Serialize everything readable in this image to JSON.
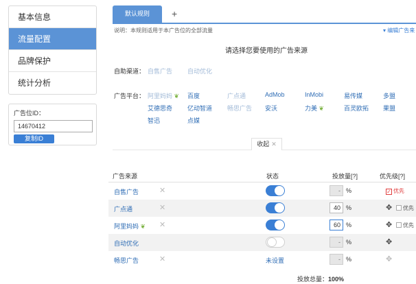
{
  "sidebar": {
    "items": [
      {
        "label": "基本信息"
      },
      {
        "label": "流量配置"
      },
      {
        "label": "品牌保护"
      },
      {
        "label": "统计分析"
      }
    ]
  },
  "ad_slot": {
    "label": "广告位ID：",
    "value": "14670412",
    "copy_label": "复制ID"
  },
  "tabs": {
    "default_label": "默认规则",
    "add_label": "+"
  },
  "note": "说明：本规则适用于本广告位的全部流量",
  "edit_note": "▾ 编辑广告来",
  "heading": "请选择您要使用的广告来源",
  "self_channel": {
    "label": "自助渠道：",
    "options": [
      "自售广告",
      "自动优化"
    ]
  },
  "platforms": {
    "label": "广告平台：",
    "items": [
      "阿里妈妈",
      "百度",
      "广点通",
      "AdMob",
      "InMobi",
      "易传媒",
      "多盟",
      "艾德思奇",
      "亿动智道",
      "畅思广告",
      "安沃",
      "力美",
      "百灵欧拓",
      "果盟",
      "智迅",
      "点媒"
    ]
  },
  "collapse": {
    "label": "收起",
    "close": "✕"
  },
  "table": {
    "headers": [
      "广告来源",
      "状态",
      "投放量[?]",
      "优先级[?]"
    ],
    "rows": [
      {
        "name": "自售广告",
        "status": "on",
        "status_text": "",
        "pct": "-",
        "priority": "优先"
      },
      {
        "name": "广点通",
        "status": "on",
        "status_text": "",
        "pct": "40",
        "priority": "优先"
      },
      {
        "name": "阿里妈妈",
        "status": "on",
        "status_text": "",
        "pct": "60",
        "priority": "优先"
      },
      {
        "name": "自动优化",
        "status": "off",
        "status_text": "",
        "pct": "-",
        "priority": ""
      },
      {
        "name": "畅思广告",
        "status": "unset",
        "status_text": "未设置",
        "pct": "-",
        "priority": ""
      }
    ],
    "pct_sign": "%",
    "del_icon": "✕",
    "move_icon": "✥"
  },
  "total": {
    "label": "投放总量：",
    "value": "100%"
  },
  "colors": {
    "accent": "#5b93d6",
    "link": "#2f6db5",
    "danger": "#e03d3d",
    "leaf": "#7cb342"
  }
}
